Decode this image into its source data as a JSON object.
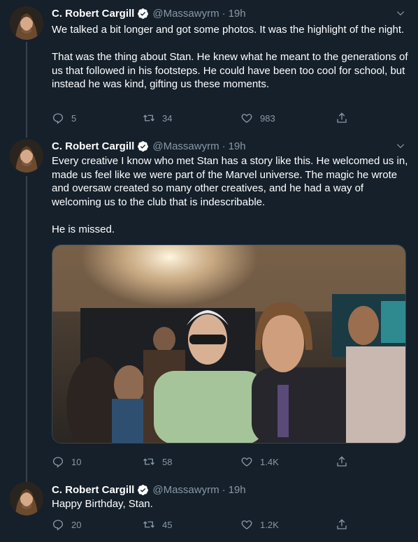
{
  "tweets": [
    {
      "author": "C. Robert Cargill",
      "handle": "@Massawyrm",
      "time": "19h",
      "paragraphs": [
        "We talked a bit longer and got some photos. It was the highlight of the night.",
        "That was the thing about Stan. He knew what he meant to the generations of us that followed in his footsteps. He could have been too cool for school, but instead he was kind, gifting us these moments."
      ],
      "replies": "5",
      "retweets": "34",
      "likes": "983"
    },
    {
      "author": "C. Robert Cargill",
      "handle": "@Massawyrm",
      "time": "19h",
      "paragraphs": [
        "Every creative I know who met Stan has a story like this. He welcomed us in, made us feel like we were part of the Marvel universe. The magic he wrote and oversaw created so many other creatives, and he had a way of welcoming us to the club that is indescribable.",
        "He is missed."
      ],
      "replies": "10",
      "retweets": "58",
      "likes": "1.4K"
    },
    {
      "author": "C. Robert Cargill",
      "handle": "@Massawyrm",
      "time": "19h",
      "paragraphs": [
        "Happy Birthday, Stan."
      ],
      "replies": "20",
      "retweets": "45",
      "likes": "1.2K"
    }
  ],
  "colors": {
    "background": "#15202b",
    "secondary_text": "#8899a6",
    "verified": "#ffffff",
    "border": "#38444d"
  },
  "icons": [
    "verified-badge-icon",
    "chevron-down-icon",
    "reply-icon",
    "retweet-icon",
    "like-icon",
    "share-icon"
  ]
}
